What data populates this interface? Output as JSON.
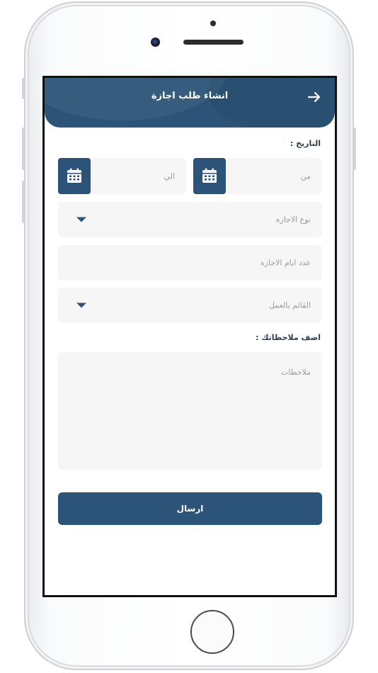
{
  "header": {
    "title": "انشاء طلب اجازة"
  },
  "form": {
    "date_label": "التاريخ :",
    "from_placeholder": "من",
    "to_placeholder": "الي",
    "leave_type_placeholder": "نوع الاجازه",
    "leave_days_placeholder": "عدد ايام الاجازه",
    "substitute_placeholder": "القائم بالعمل",
    "notes_label": "اضف ملاحظاتك :",
    "notes_placeholder": "ملاحظات",
    "submit_label": "ارسال"
  },
  "colors": {
    "primary": "#2c5478",
    "field_bg": "#f6f6f7",
    "placeholder": "#9a9a9a"
  },
  "icons": {
    "back": "arrow-right-icon",
    "calendar": "calendar-icon",
    "dropdown": "caret-down-icon"
  }
}
